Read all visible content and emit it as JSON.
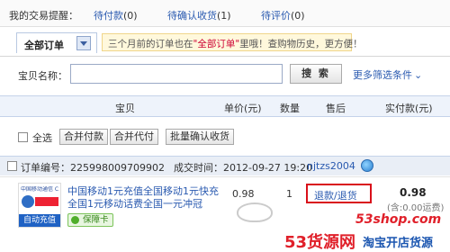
{
  "reminders": {
    "title": "我的交易提醒：",
    "items": [
      {
        "label": "待付款",
        "count": "(0)"
      },
      {
        "label": "待确认收货",
        "count": "(1)"
      },
      {
        "label": "待评价",
        "count": "(0)"
      }
    ]
  },
  "filter_tab": {
    "label": "全部订单",
    "notice_prefix": "三个月前的订单也在",
    "notice_highlight": "\"全部订单\"",
    "notice_suffix": "里哦！查购物历史，更方便！"
  },
  "search": {
    "label": "宝贝名称：",
    "value": "",
    "button_label": "搜 索",
    "more_filters": "更多筛选条件",
    "more_filters_icon": "chevron-down-icon"
  },
  "columns": [
    "宝贝",
    "单价(元)",
    "数量",
    "售后",
    "实付款(元)"
  ],
  "bulk_actions": {
    "select_all": "全选",
    "buttons": [
      "合并付款",
      "合并代付",
      "批量确认收货"
    ]
  },
  "order": {
    "order_number_label": "订单编号：",
    "order_number": "225998009709902",
    "created_label": "成交时间：",
    "created_time": "2012-09-27 19:20",
    "seller": "njtzs2004",
    "item": {
      "thumb_brand": "中国移动通信 CHINA MOBILE",
      "thumb_banner": "自动充值",
      "title": "中国移动1元充值全国移动1元快充全国1元移动话费全国一元冲冠",
      "insurance": "保障卡",
      "unit_price": "0.98",
      "quantity": "1",
      "after_sale": "退款/退货",
      "paid_amount": "0.98",
      "shipping_note": "(含:0.00运费)"
    }
  },
  "watermark": {
    "url": "53shop.com",
    "logo": "53货源网",
    "slogan": "淘宝开店货源"
  }
}
